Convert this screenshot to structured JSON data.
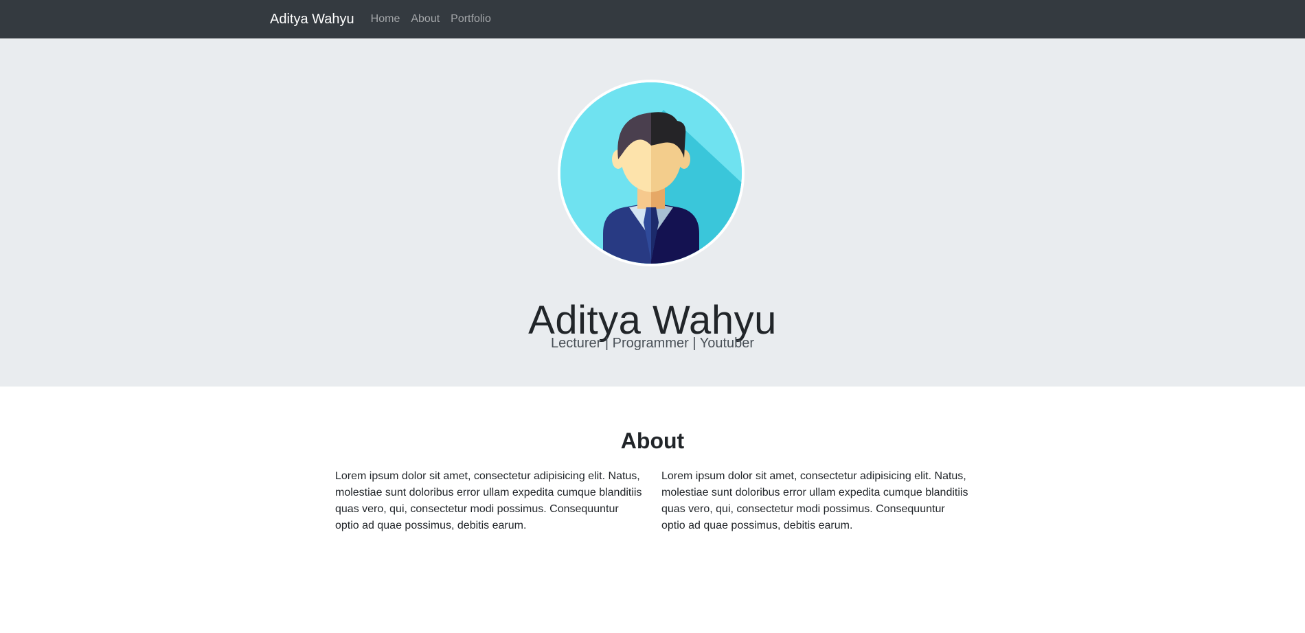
{
  "navbar": {
    "brand": "Aditya Wahyu",
    "links": [
      "Home",
      "About",
      "Portfolio"
    ]
  },
  "hero": {
    "avatar_icon": "person-avatar-icon",
    "name": "Aditya Wahyu",
    "subtitle": "Lecturer | Programmer | Youtuber"
  },
  "about": {
    "title": "About",
    "columns": [
      "Lorem ipsum dolor sit amet, consectetur adipisicing elit. Natus, molestiae sunt doloribus error ullam expedita cumque blanditiis quas vero, qui, consectetur modi possimus. Consequuntur optio ad quae possimus, debitis earum.",
      "Lorem ipsum dolor sit amet, consectetur adipisicing elit. Natus, molestiae sunt doloribus error ullam expedita cumque blanditiis quas vero, qui, consectetur modi possimus. Consequuntur optio ad quae possimus, debitis earum."
    ]
  },
  "colors": {
    "navbar_bg": "#343a40",
    "jumbotron_bg": "#e9ecef",
    "avatar_bg": "#6fe2f0"
  }
}
